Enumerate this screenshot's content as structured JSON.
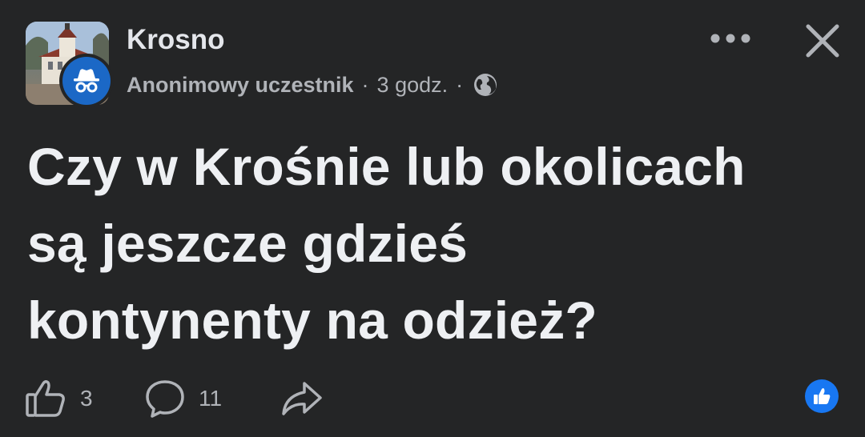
{
  "header": {
    "group_name": "Krosno",
    "author": "Anonimowy uczestnik",
    "separator": "·",
    "time": "3 godz.",
    "avatar_icon": "group-photo-town-hall",
    "badge_icon": "anonymous-incognito-icon",
    "badge_color": "#1b68c6",
    "privacy_icon": "globe-icon",
    "more_icon": "more-dots-icon",
    "close_icon": "close-icon"
  },
  "post": {
    "line1": "Czy w Krośnie lub okolicach",
    "line2": "są jeszcze gdzieś",
    "line3": "kontynenty na odzież?"
  },
  "footer": {
    "like_icon": "thumbs-up-icon",
    "like_count": "3",
    "comment_icon": "comment-bubble-icon",
    "comment_count": "11",
    "share_icon": "share-arrow-icon",
    "reaction_icon": "like-reaction-icon",
    "reaction_color": "#1877f2"
  },
  "colors": {
    "background": "#242526",
    "primary_text": "#e4e6eb",
    "secondary_text": "#b0b3b8"
  }
}
